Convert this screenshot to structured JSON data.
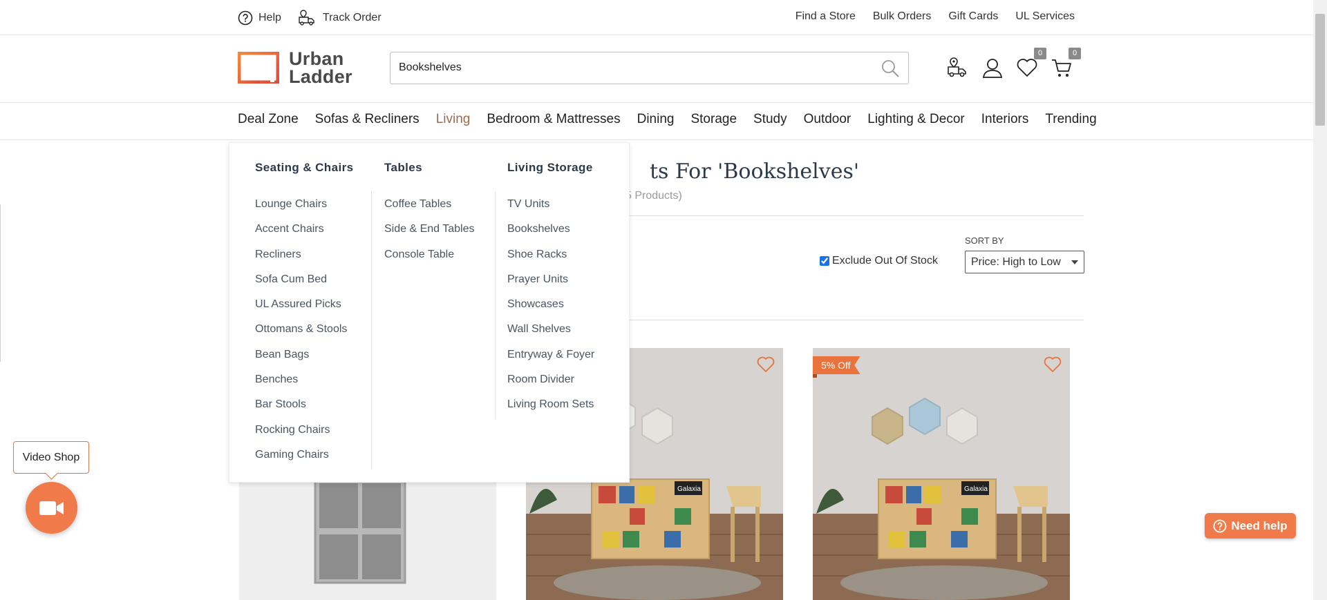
{
  "topbar": {
    "help": "Help",
    "track_order": "Track Order",
    "right_links": [
      "Find a Store",
      "Bulk Orders",
      "Gift Cards",
      "UL Services"
    ]
  },
  "header": {
    "logo_line1": "Urban",
    "logo_line2": "Ladder",
    "search_value": "Bookshelves",
    "wishlist_count": "0",
    "cart_count": "0"
  },
  "nav": {
    "items": [
      "Deal Zone",
      "Sofas & Recliners",
      "Living",
      "Bedroom & Mattresses",
      "Dining",
      "Storage",
      "Study",
      "Outdoor",
      "Lighting & Decor",
      "Interiors",
      "Trending"
    ],
    "active": "Living"
  },
  "results": {
    "title": "ts For 'Bookshelves'",
    "count": "5 Products)",
    "exclude_label": "Exclude Out Of Stock",
    "exclude_checked": true,
    "sort_label": "SORT BY",
    "sort_value": "Price: High to Low"
  },
  "products": [
    {
      "ribbon": ""
    },
    {
      "ribbon": ""
    },
    {
      "ribbon": "5% Off",
      "book_label": "Galaxia"
    }
  ],
  "product_mid": {
    "book_label": "Galaxia"
  },
  "mega_menu": {
    "col1": {
      "heading": "Seating & Chairs",
      "items": [
        "Lounge Chairs",
        "Accent Chairs",
        "Recliners",
        "Sofa Cum Bed",
        "UL Assured Picks",
        "Ottomans & Stools",
        "Bean Bags",
        "Benches",
        "Bar Stools",
        "Rocking Chairs",
        "Gaming Chairs"
      ]
    },
    "col2": {
      "heading": "Tables",
      "items": [
        "Coffee Tables",
        "Side & End Tables",
        "Console Table"
      ]
    },
    "col3": {
      "heading": "Living Storage",
      "items": [
        "TV Units",
        "Bookshelves",
        "Shoe Racks",
        "Prayer Units",
        "Showcases",
        "Wall Shelves",
        "Entryway & Foyer",
        "Room Divider",
        "Living Room Sets"
      ]
    }
  },
  "floating": {
    "video_shop": "Video Shop",
    "need_help": "Need help"
  },
  "colors": {
    "accent": "#f07a4a",
    "nav_active": "#a0694b",
    "heading": "#2b3a4a"
  }
}
